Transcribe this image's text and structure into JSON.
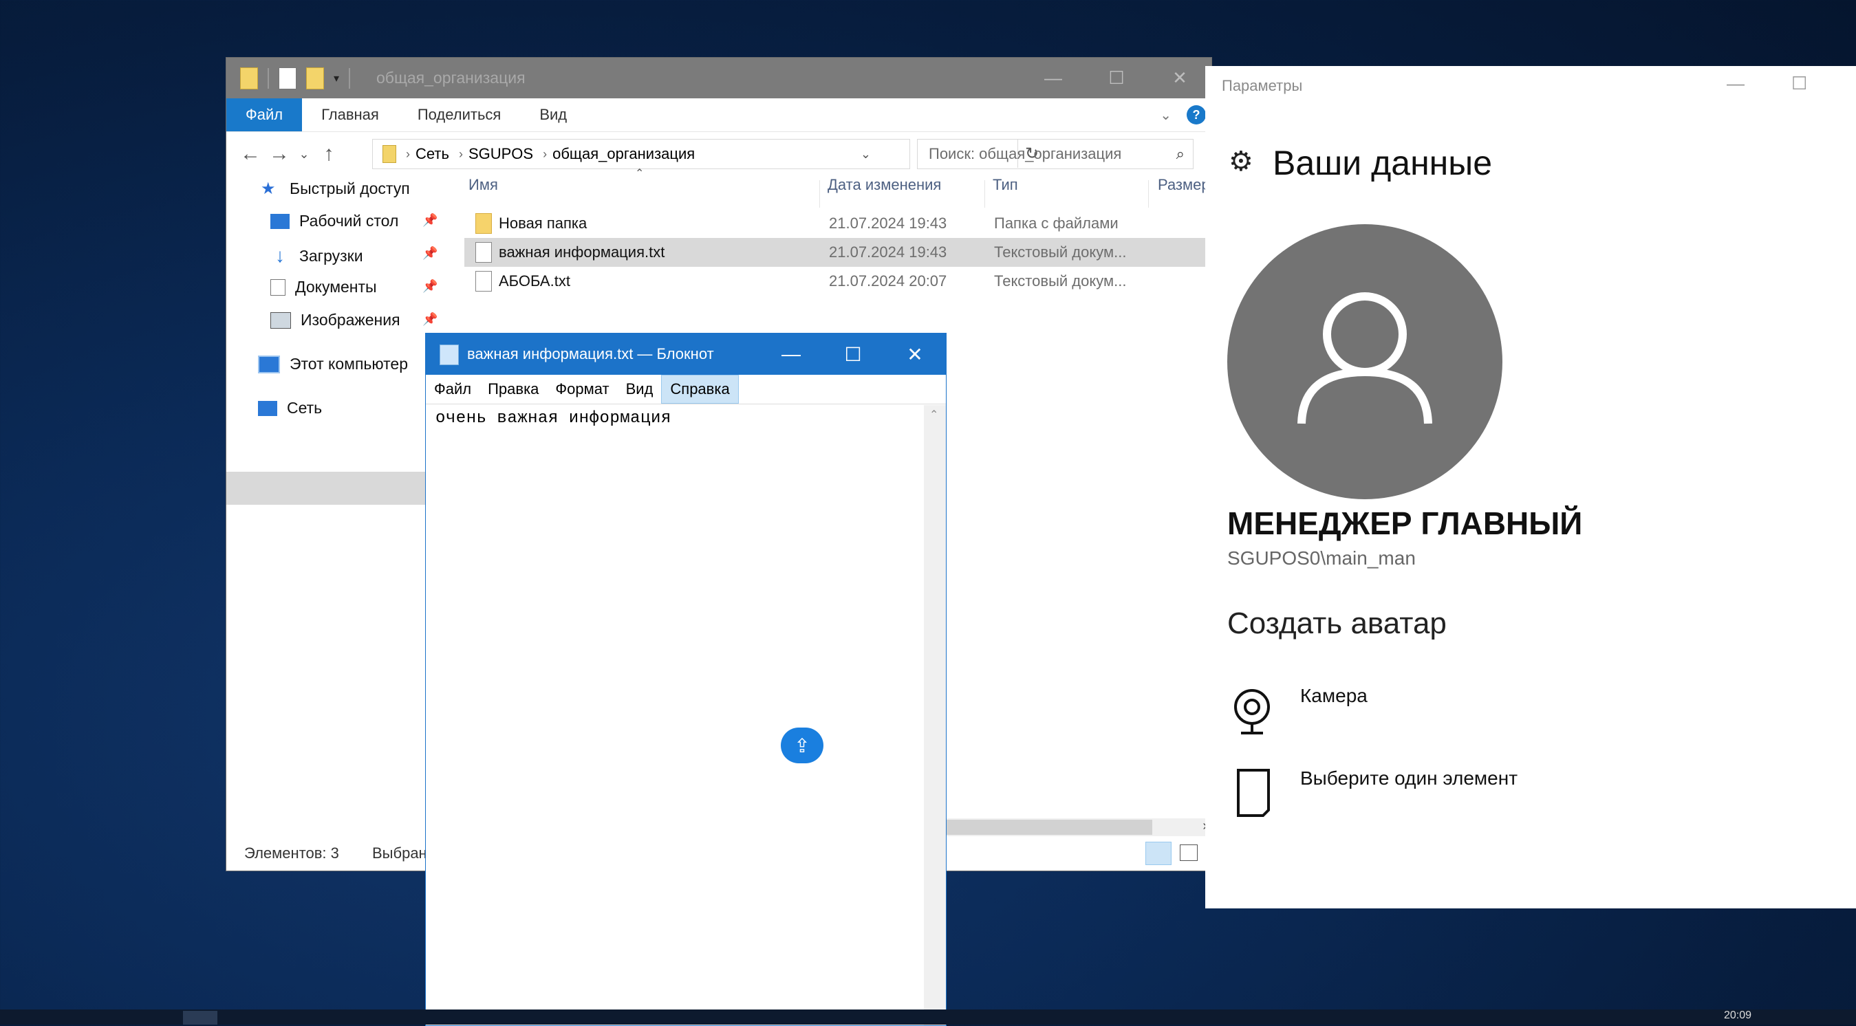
{
  "explorer": {
    "title": "общая_организация",
    "ribbon_tabs": [
      "Файл",
      "Главная",
      "Поделиться",
      "Вид"
    ],
    "help": "?",
    "address": [
      "Сеть",
      "SGUPOS",
      "общая_организация"
    ],
    "search_placeholder": "Поиск: общая_организация",
    "nav": {
      "quick_access": "Быстрый доступ",
      "desktop": "Рабочий стол",
      "downloads": "Загрузки",
      "documents": "Документы",
      "pictures": "Изображения",
      "this_pc": "Этот компьютер",
      "network": "Сеть"
    },
    "columns": {
      "name": "Имя",
      "date": "Дата изменения",
      "type": "Тип",
      "size": "Размер"
    },
    "rows": [
      {
        "name": "Новая папка",
        "date": "21.07.2024 19:43",
        "type": "Папка с файлами"
      },
      {
        "name": "важная информация.txt",
        "date": "21.07.2024 19:43",
        "type": "Текстовый докум..."
      },
      {
        "name": "АБОБА.txt",
        "date": "21.07.2024 20:07",
        "type": "Текстовый докум..."
      }
    ],
    "status_count": "Элементов: 3",
    "status_selected": "Выбран"
  },
  "notepad": {
    "title": "важная информация.txt — Блокнот",
    "menu": [
      "Файл",
      "Правка",
      "Формат",
      "Вид",
      "Справка"
    ],
    "content": "очень важная информация"
  },
  "settings": {
    "window_title": "Параметры",
    "heading": "Ваши данные",
    "user_name": "МЕНЕДЖЕР ГЛАВНЫЙ",
    "account": "SGUPOS0\\main_man",
    "create_avatar": "Создать аватар",
    "camera": "Камера",
    "choose": "Выберите один элемент"
  },
  "taskbar": {
    "clock": "20:09"
  }
}
